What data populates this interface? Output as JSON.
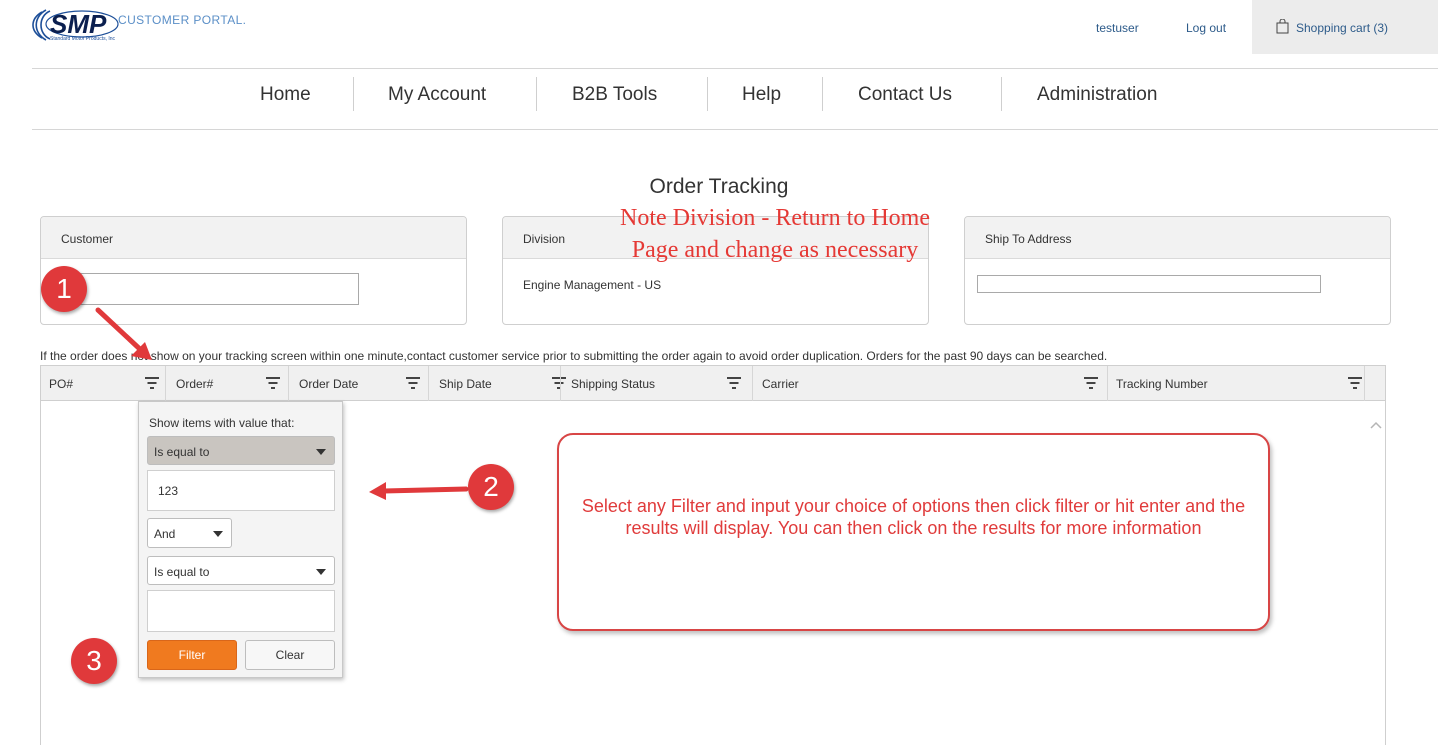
{
  "header": {
    "logo_text": "SMP",
    "logo_tagline": "Standard Motor Products, Inc",
    "portal_label": "CUSTOMER PORTAL.",
    "username": "testuser",
    "logout_label": "Log out",
    "cart_label": "Shopping cart (3)"
  },
  "nav": {
    "items": [
      {
        "label": "Home"
      },
      {
        "label": "My Account"
      },
      {
        "label": "B2B Tools"
      },
      {
        "label": "Help"
      },
      {
        "label": "Contact Us"
      },
      {
        "label": "Administration"
      }
    ]
  },
  "page": {
    "title": "Order Tracking",
    "note_line1": "Note Division - Return to Home",
    "note_line2": "Page and change as necessary"
  },
  "panels": {
    "customer": {
      "label": "Customer",
      "value": ""
    },
    "division": {
      "label": "Division",
      "value": "Engine Management - US"
    },
    "ship_to": {
      "label": "Ship To Address",
      "value": ""
    }
  },
  "info_text": "If the order does not show on your tracking screen within one minute,contact customer service prior to submitting the order again to avoid order duplication. Orders for the past 90 days can be searched.",
  "grid": {
    "columns": [
      {
        "label": "PO#"
      },
      {
        "label": "Order#"
      },
      {
        "label": "Order Date"
      },
      {
        "label": "Ship Date"
      },
      {
        "label": "Shipping Status"
      },
      {
        "label": "Carrier"
      },
      {
        "label": "Tracking Number"
      }
    ]
  },
  "filter_popup": {
    "label": "Show items with value that:",
    "operator1": "Is equal to",
    "value1": "123",
    "logic": "And",
    "operator2": "Is equal to",
    "value2": "",
    "filter_button": "Filter",
    "clear_button": "Clear"
  },
  "annotations": {
    "badge1": "1",
    "badge2": "2",
    "badge3": "3",
    "callout_text": "Select any Filter and input your choice of options then click filter or hit enter and the results will display. You can then click on the results for more information"
  },
  "colors": {
    "accent_blue": "#2d5b8a",
    "annotation_red": "#e0393b",
    "filter_orange": "#f07a1f"
  }
}
